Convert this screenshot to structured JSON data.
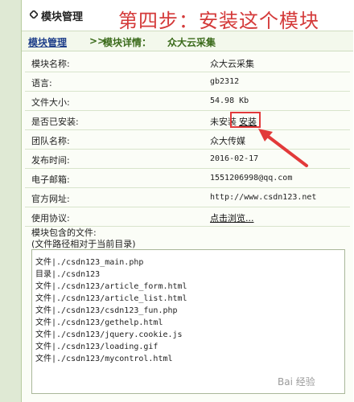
{
  "header": {
    "title": "模块管理",
    "step_overlay": "第四步：安装这个模块"
  },
  "breadcrumb": {
    "root": "模块管理",
    "separator": ">>",
    "detail_label": "模块详情：",
    "module_name": "众大云采集"
  },
  "details": [
    {
      "key": "模块名称:",
      "value": "众大云采集"
    },
    {
      "key": "语言:",
      "value": "gb2312"
    },
    {
      "key": "文件大小:",
      "value": "54.98 Kb"
    },
    {
      "key": "是否已安装:",
      "value": "未安装",
      "action": "安装"
    },
    {
      "key": "团队名称:",
      "value": "众大传媒"
    },
    {
      "key": "发布时间:",
      "value": "2016-02-17"
    },
    {
      "key": "电子邮箱:",
      "value": "1551206998@qq.com"
    },
    {
      "key": "官方网址:",
      "value": "http://www.csdn123.net"
    },
    {
      "key": "使用协议:",
      "action": "点击浏览..."
    }
  ],
  "files": {
    "label": "模块包含的文件:",
    "note": "(文件路径相对于当前目录)",
    "list": [
      "文件|./csdn123_main.php",
      "目录|./csdn123",
      "文件|./csdn123/article_form.html",
      "文件|./csdn123/article_list.html",
      "文件|./csdn123/csdn123_fun.php",
      "文件|./csdn123/gethelp.html",
      "文件|./csdn123/jquery.cookie.js",
      "文件|./csdn123/loading.gif",
      "文件|./csdn123/mycontrol.html"
    ]
  },
  "watermark": "Bai 经验",
  "colors": {
    "accent_red": "#e23a3a",
    "crumb_green": "#3a6a1a",
    "link_blue": "#1f3f8a",
    "panel_bg": "#fbfdf7"
  },
  "icons": {
    "header": "diamond-bullet-icon",
    "annotation": "red-arrow-icon"
  }
}
